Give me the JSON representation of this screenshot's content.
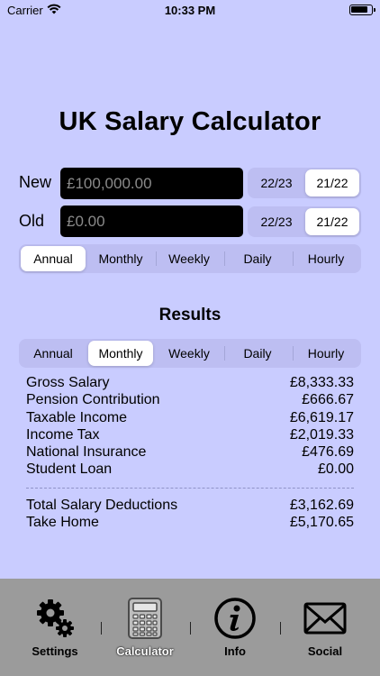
{
  "status_bar": {
    "carrier": "Carrier",
    "time": "10:33 PM",
    "wifi_icon": "wifi-icon",
    "battery_icon": "battery-icon"
  },
  "title": "UK Salary Calculator",
  "new_salary": {
    "label": "New",
    "placeholder": "£100,000.00",
    "value": "",
    "years": [
      "22/23",
      "21/22"
    ],
    "selected_year": "21/22"
  },
  "old_salary": {
    "label": "Old",
    "placeholder": "£0.00",
    "value": "",
    "years": [
      "22/23",
      "21/22"
    ],
    "selected_year": "21/22"
  },
  "input_period": {
    "options": [
      "Annual",
      "Monthly",
      "Weekly",
      "Daily",
      "Hourly"
    ],
    "selected": "Annual"
  },
  "results": {
    "title": "Results",
    "period": {
      "options": [
        "Annual",
        "Monthly",
        "Weekly",
        "Daily",
        "Hourly"
      ],
      "selected": "Monthly"
    },
    "rows": [
      {
        "label": "Gross Salary",
        "value": "£8,333.33"
      },
      {
        "label": "Pension Contribution",
        "value": "£666.67"
      },
      {
        "label": "Taxable Income",
        "value": "£6,619.17"
      },
      {
        "label": "Income Tax",
        "value": "£2,019.33"
      },
      {
        "label": "National Insurance",
        "value": "£476.69"
      },
      {
        "label": "Student Loan",
        "value": "£0.00"
      }
    ],
    "totals": [
      {
        "label": "Total Salary Deductions",
        "value": "£3,162.69"
      },
      {
        "label": "Take Home",
        "value": "£5,170.65"
      }
    ]
  },
  "tabs": [
    {
      "label": "Settings",
      "icon": "gears-icon"
    },
    {
      "label": "Calculator",
      "icon": "calculator-icon",
      "selected": true
    },
    {
      "label": "Info",
      "icon": "info-icon"
    },
    {
      "label": "Social",
      "icon": "envelope-icon"
    }
  ],
  "colors": {
    "background": "#c9ccff",
    "input_background": "#000000",
    "tab_bar": "#9b9b9b",
    "segment_track": "#bdbef2"
  }
}
